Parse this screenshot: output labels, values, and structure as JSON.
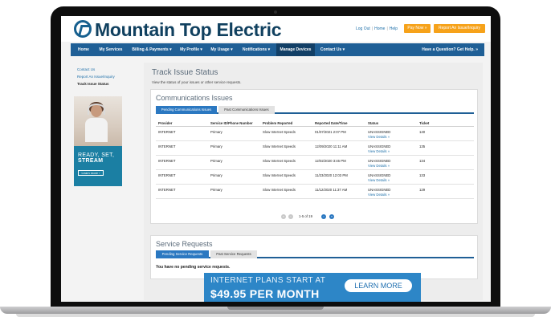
{
  "header": {
    "brand": "Mountain Top Electric",
    "util_links": [
      "Log Out",
      "Home",
      "Help"
    ],
    "pay_now": "Pay Now »",
    "report_issue": "Report An Issue/Inquiry"
  },
  "nav": {
    "items": [
      {
        "label": "Home"
      },
      {
        "label": "My Services"
      },
      {
        "label": "Billing & Payments ▾"
      },
      {
        "label": "My Profile ▾"
      },
      {
        "label": "My Usage ▾"
      },
      {
        "label": "Notifications ▾"
      },
      {
        "label": "Manage Devices"
      },
      {
        "label": "Contact Us ▾"
      }
    ],
    "help": "Have a Question? Get Help. »"
  },
  "sidebar": {
    "links": [
      "Contact Us",
      "Report An Issue/Inquiry",
      "Track Issue Status"
    ],
    "ad": {
      "line1": "READY, SET,",
      "line2": "STREAM",
      "button": "Learn more ›"
    }
  },
  "main": {
    "title": "Track Issue Status",
    "subtitle": "View the status of your issues or other service requests."
  },
  "comm": {
    "title": "Communications Issues",
    "tabs": [
      "Pending Communications Issues",
      "Past Communications Issues"
    ],
    "columns": [
      "Provider",
      "Service ID/Phone Number",
      "Problem Reported",
      "Reported Date/Time",
      "Status",
      "Ticket"
    ],
    "rows": [
      {
        "provider": "INTERNET",
        "service": "Primary",
        "problem": "Slow Internet Speeds",
        "date": "01/07/2021 2:07 PM",
        "status": "UNASSIGNED",
        "link": "View Details »",
        "ticket": "140"
      },
      {
        "provider": "INTERNET",
        "service": "Primary",
        "problem": "Slow Internet Speeds",
        "date": "12/09/2020 11:11 AM",
        "status": "UNASSIGNED",
        "link": "View Details »",
        "ticket": "135"
      },
      {
        "provider": "INTERNET",
        "service": "Primary",
        "problem": "Slow Internet Speeds",
        "date": "12/02/2020 3:46 PM",
        "status": "UNASSIGNED",
        "link": "View Details »",
        "ticket": "134"
      },
      {
        "provider": "INTERNET",
        "service": "Primary",
        "problem": "Slow Internet Speeds",
        "date": "11/23/2020 12:03 PM",
        "status": "UNASSIGNED",
        "link": "View Details »",
        "ticket": "133"
      },
      {
        "provider": "INTERNET",
        "service": "Primary",
        "problem": "Slow Internet Speeds",
        "date": "11/12/2020 11:37 AM",
        "status": "UNASSIGNED",
        "link": "View Details »",
        "ticket": "129"
      }
    ],
    "pager": {
      "first": "«",
      "prev": "‹",
      "text": "1-5 of 19",
      "next": "›",
      "last": "»"
    }
  },
  "svc": {
    "title": "Service Requests",
    "tabs": [
      "Pending Service Requests",
      "Past Service Requests"
    ],
    "empty": "You have no pending service requests."
  },
  "banner": {
    "line1": "INTERNET PLANS START AT",
    "line2": "$49.95 PER MONTH",
    "button": "LEARN MORE"
  },
  "colors": {
    "nav": "#1f5f96",
    "accent": "#f6a21a",
    "link": "#1d6fa9",
    "tab_active": "#2b78c1"
  }
}
